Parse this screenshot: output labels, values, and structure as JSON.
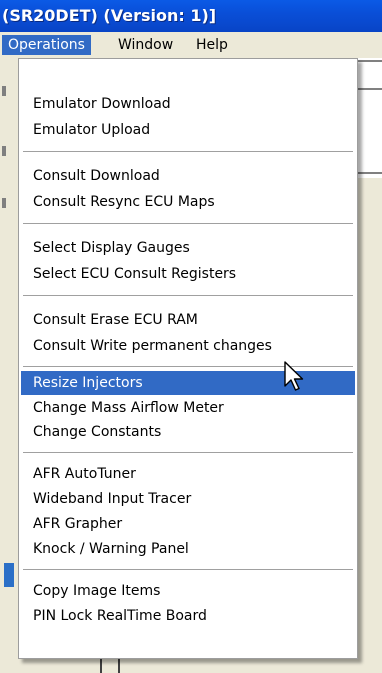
{
  "window": {
    "title": "(SR20DET) (Version: 1)]"
  },
  "menubar": {
    "items": [
      "Operations",
      "Window",
      "Help"
    ],
    "active": "Operations"
  },
  "menu": {
    "groups": [
      [
        "Emulator Download",
        "Emulator Upload"
      ],
      [
        "Consult Download",
        "Consult Resync ECU Maps"
      ],
      [
        "Select Display Gauges",
        "Select ECU Consult Registers"
      ],
      [
        "Consult Erase ECU RAM",
        "Consult Write permanent changes"
      ],
      [
        "Resize Injectors",
        "Change Mass Airflow Meter",
        "Change Constants"
      ],
      [
        "AFR AutoTuner",
        "Wideband Input Tracer",
        "AFR Grapher",
        "Knock / Warning Panel"
      ],
      [
        "Copy Image Items",
        "PIN Lock RealTime Board"
      ]
    ],
    "highlighted": "Resize Injectors"
  },
  "colors": {
    "highlight": "#316ac5",
    "menubar": "#ece9d8",
    "titlebar": "#0a4fd8"
  },
  "icons": {
    "cursor": "mouse-pointer-arrow-icon"
  }
}
